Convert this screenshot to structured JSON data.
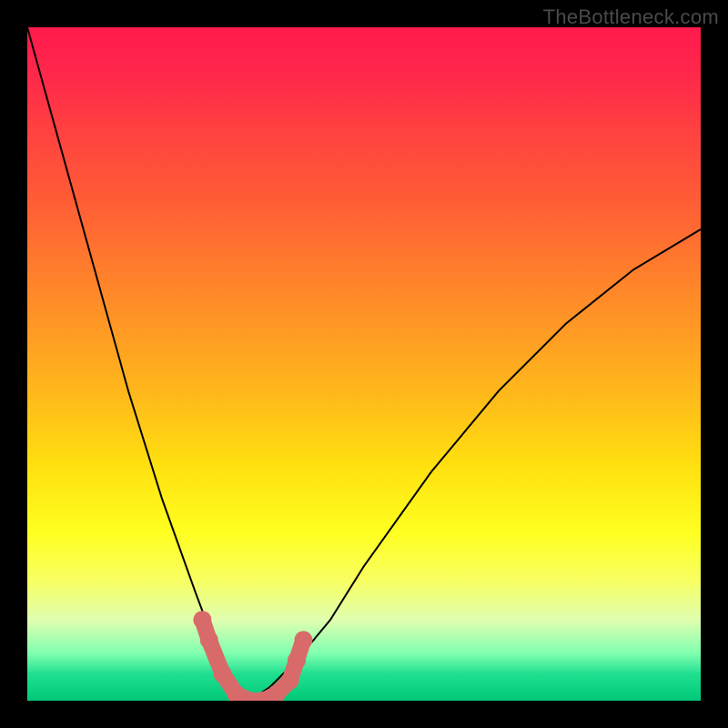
{
  "watermark": "TheBottleneck.com",
  "chart_data": {
    "type": "line",
    "title": "",
    "xlabel": "",
    "ylabel": "",
    "xlim": [
      0,
      100
    ],
    "ylim": [
      0,
      100
    ],
    "description": "V-shaped bottleneck curve on rainbow gradient; minimum near x≈33, salmon-colored markers cluster near the valley bottom.",
    "series": [
      {
        "name": "left-curve",
        "x": [
          0,
          5,
          10,
          15,
          20,
          25,
          28,
          30,
          32,
          33
        ],
        "values": [
          100,
          82,
          64,
          46,
          30,
          16,
          8,
          4,
          1,
          0
        ]
      },
      {
        "name": "right-curve",
        "x": [
          33,
          36,
          40,
          45,
          50,
          60,
          70,
          80,
          90,
          100
        ],
        "values": [
          0,
          2,
          6,
          12,
          20,
          34,
          46,
          56,
          64,
          70
        ]
      }
    ],
    "markers": {
      "name": "valley-markers",
      "x": [
        26,
        27,
        29,
        31,
        33,
        35,
        37,
        39,
        40,
        41
      ],
      "values": [
        12,
        9,
        4,
        1,
        0,
        0,
        1,
        3,
        6,
        9
      ]
    }
  },
  "colors": {
    "gradient_top": "#ff1a4d",
    "gradient_mid": "#ffff20",
    "gradient_bottom": "#00c878",
    "curve": "#000000",
    "markers": "#d96a6a",
    "frame": "#000000"
  }
}
